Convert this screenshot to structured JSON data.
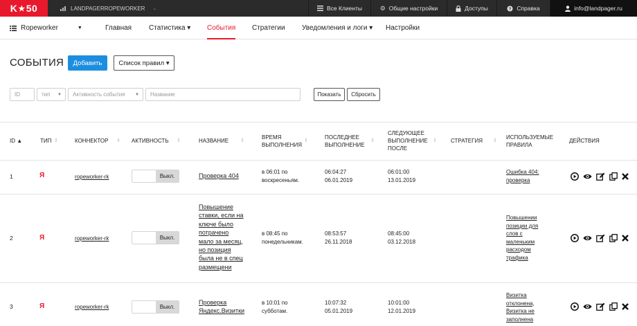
{
  "topbar": {
    "logo_left": "K",
    "logo_star": "★",
    "logo_right": "50",
    "project": "LANDPAGERROPEWORKER",
    "items": [
      {
        "icon": "list-icon",
        "label": "Все Клиенты"
      },
      {
        "icon": "gear-icon",
        "label": "Общие настройки"
      },
      {
        "icon": "lock-icon",
        "label": "Доступы"
      },
      {
        "icon": "help-icon",
        "label": "Справка"
      },
      {
        "icon": "user-icon",
        "label": "info@landpager.ru"
      }
    ]
  },
  "nav": {
    "brand": "Ropeworker",
    "items": [
      {
        "label": "Главная"
      },
      {
        "label": "Статистика ▾"
      },
      {
        "label": "События"
      },
      {
        "label": "Стратегии"
      },
      {
        "label": "Уведомления и логи ▾"
      },
      {
        "label": "Настройки"
      }
    ]
  },
  "page": {
    "title": "СОБЫТИЯ",
    "add_label": "Добавить",
    "rules_label": "Список правил ▾"
  },
  "filters": {
    "id": "ID",
    "type": "тип",
    "activity": "Активность события",
    "name": "Название",
    "show": "Показать",
    "reset": "Сбросить"
  },
  "table": {
    "headers": {
      "id": "ID ▲",
      "type": "ТИП",
      "connector": "КОННЕКТОР",
      "activity": "АКТИВНОСТЬ",
      "name": "НАЗВАНИЕ",
      "time": [
        "ВРЕМЯ",
        "ВЫПОЛНЕНИЯ"
      ],
      "last": [
        "ПОСЛЕДНЕЕ",
        "ВЫПОЛНЕНИЕ"
      ],
      "next": [
        "СЛЕДУЮЩЕЕ",
        "ВЫПОЛНЕНИЕ",
        "ПОСЛЕ"
      ],
      "strategy": "СТРАТЕГИЯ",
      "rules": [
        "ИСПОЛЬЗУЕМЫЕ",
        "ПРАВИЛА"
      ],
      "actions": "ДЕЙСТВИЯ"
    },
    "rows": [
      {
        "id": "1",
        "type": "Я",
        "connector": "ropeworker-rk",
        "toggle": "Выкл.",
        "name": [
          "Проверка 404"
        ],
        "time": [
          "в 06:01 по",
          "воскресеньям."
        ],
        "last": [
          "06:04:27",
          "06.01.2019"
        ],
        "next": [
          "06:01:00",
          "13.01.2019"
        ],
        "rules": [
          "Ошибка 404:",
          "проверка"
        ]
      },
      {
        "id": "2",
        "type": "Я",
        "connector": "ropeworker-rk",
        "toggle": "Выкл.",
        "name": [
          "Повышение",
          "ставки, если на",
          "ключе было",
          "потрачено",
          "мало за месяц,",
          "но позиция",
          "была не в спец",
          "размещени"
        ],
        "time": [
          "в 08:45 по",
          "понедельникам."
        ],
        "last": [
          "08:53:57",
          "26.11.2018"
        ],
        "next": [
          "08:45:00",
          "03.12.2018"
        ],
        "rules": [
          "Повышении",
          "позиции для",
          "слов с",
          "маленьким",
          "расходом",
          "трафика"
        ]
      },
      {
        "id": "3",
        "type": "Я",
        "connector": "ropeworker-rk",
        "toggle": "Выкл.",
        "name": [
          "Проверка",
          "Яндекс.Визитки"
        ],
        "time": [
          "в 10:01 по",
          "субботам."
        ],
        "last": [
          "10:07:32",
          "05.01.2019"
        ],
        "next": [
          "10:01:00",
          "12.01.2019"
        ],
        "rules": [
          "Визитка",
          "отклонена,",
          "Визитка не",
          "заполнена"
        ]
      }
    ]
  }
}
